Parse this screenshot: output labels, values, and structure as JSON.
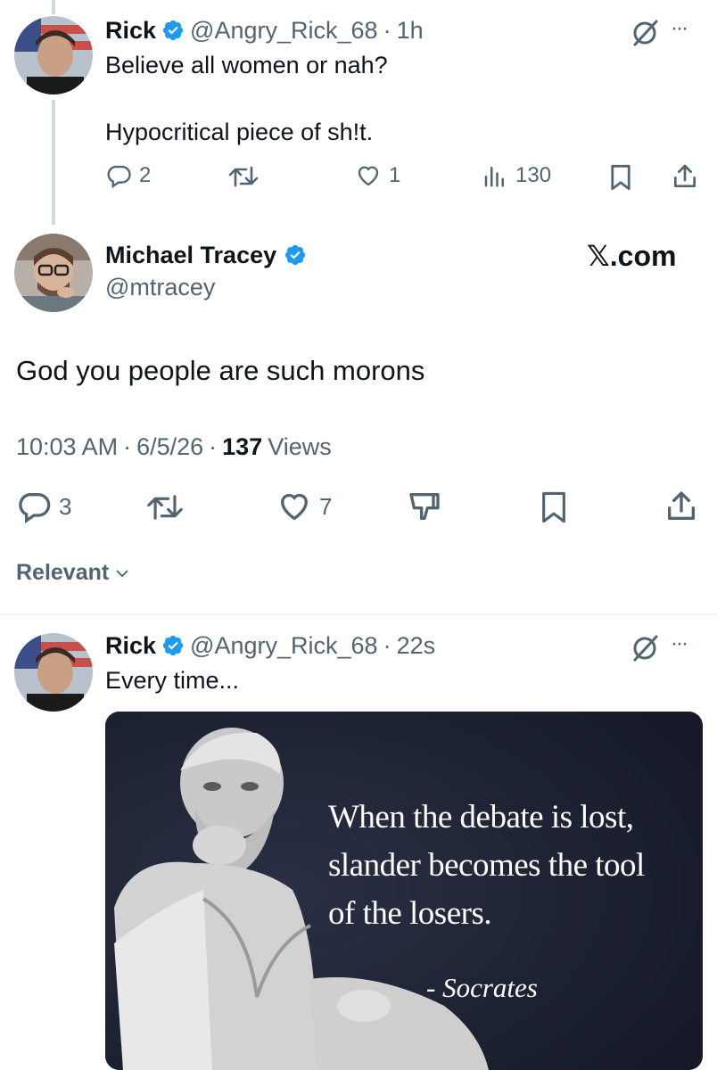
{
  "reply_parent": {
    "name": "Rick",
    "handle": "@Angry_Rick_68",
    "time": "1h",
    "text_line1": "Believe all women or nah?",
    "text_line2": "Hypocritical piece of sh!t.",
    "replies": "2",
    "likes": "1",
    "views": "130",
    "more": "···"
  },
  "main_tweet": {
    "name": "Michael Tracey",
    "handle": "@mtracey",
    "watermark": "𝕏.com",
    "text": "God you people are such morons",
    "time": "10:03 AM",
    "date": "6/5/26",
    "views_count": "137",
    "views_label": "Views",
    "replies": "3",
    "likes": "7"
  },
  "sort": {
    "label": "Relevant"
  },
  "reply": {
    "name": "Rick",
    "handle": "@Angry_Rick_68",
    "time": "22s",
    "text": "Every time...",
    "more": "···",
    "image": {
      "quote_line1": "When the debate is lost,",
      "quote_line2": "slander becomes the tool",
      "quote_line3": "of the losers.",
      "attribution": "- Socrates"
    }
  },
  "colors": {
    "accent": "#1d9bf0",
    "muted": "#536471",
    "divider": "#eff3f4"
  }
}
